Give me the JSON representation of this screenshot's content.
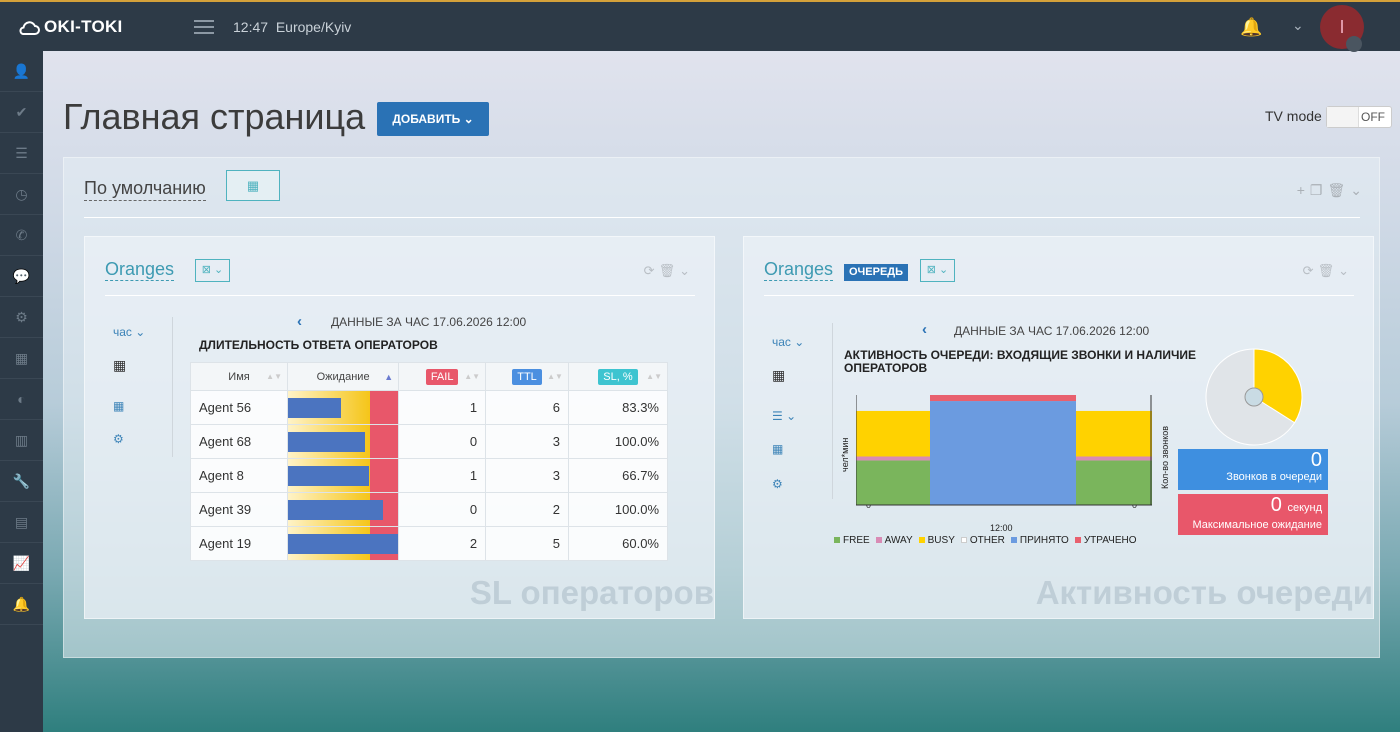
{
  "topbar": {
    "logo": "OKI-TOKI",
    "time": "12:47",
    "timezone": "Europe/Kyiv",
    "avatar_letter": "I"
  },
  "sidebar": {
    "icons": [
      "user-icon",
      "check-icon",
      "list-icon",
      "clock-icon",
      "phone-icon",
      "chat-icon",
      "gears-icon",
      "grid-icon",
      "toggle-icon",
      "bar-chart-icon",
      "wrench-icon",
      "table-icon",
      "line-chart-icon",
      "bell-icon"
    ]
  },
  "page": {
    "title": "Главная страница",
    "add_button": "ДОБАВИТЬ",
    "tv_label": "TV mode",
    "tv_state": "OFF"
  },
  "dashboard": {
    "title": "По умолчанию"
  },
  "widget1": {
    "title": "Oranges",
    "period": "час",
    "data_label": "ДАННЫЕ ЗА  ЧАС  17.06.2026 12:00",
    "chart_title": "ДЛИТЕЛЬНОСТЬ ОТВЕТА ОПЕРАТОРОВ",
    "columns": {
      "name": "Имя",
      "wait": "Ожидание",
      "fail": "FAIL",
      "ttl": "TTL",
      "sl": "SL, %"
    },
    "rows": [
      {
        "name": "Agent 56",
        "wait": 0.48,
        "fail": "1",
        "ttl": "6",
        "sl": "83.3%"
      },
      {
        "name": "Agent 68",
        "wait": 0.7,
        "fail": "0",
        "ttl": "3",
        "sl": "100.0%"
      },
      {
        "name": "Agent 8",
        "wait": 0.74,
        "fail": "1",
        "ttl": "3",
        "sl": "66.7%"
      },
      {
        "name": "Agent 39",
        "wait": 0.86,
        "fail": "0",
        "ttl": "2",
        "sl": "100.0%"
      },
      {
        "name": "Agent 19",
        "wait": 1.0,
        "fail": "2",
        "ttl": "5",
        "sl": "60.0%"
      }
    ],
    "watermark": "SL операторов"
  },
  "widget2": {
    "title": "Oranges",
    "badge": "ОЧЕРЕДЬ",
    "period": "час",
    "data_label": "ДАННЫЕ ЗА  ЧАС  17.06.2026 12:00",
    "chart_title": "АКТИВНОСТЬ ОЧЕРЕДИ: ВХОДЯЩИЕ ЗВОНКИ И НАЛИЧИЕ ОПЕРАТОРОВ",
    "y_left_label": "чел*мин",
    "y_right_label": "Кол-во звонков",
    "x_tick": "12:00",
    "y_left_ticks": [
      "0",
      "100",
      "200"
    ],
    "y_right_ticks": [
      "0",
      "10",
      "20"
    ],
    "legend": [
      {
        "name": "FREE",
        "color": "#7ab55c"
      },
      {
        "name": "AWAY",
        "color": "#d98bb5"
      },
      {
        "name": "BUSY",
        "color": "#ffd200"
      },
      {
        "name": "OTHER",
        "color": "#ffffff"
      },
      {
        "name": "ПРИНЯТО",
        "color": "#6b9be0"
      },
      {
        "name": "УТРАЧЕНО",
        "color": "#e8606e"
      }
    ],
    "queue_value": "0",
    "queue_label": "Звонков в очереди",
    "wait_value": "0",
    "wait_unit": "секунд",
    "wait_label": "Максимальное ожидание",
    "watermark": "Активность очереди"
  },
  "chart_data": [
    {
      "type": "bar",
      "title": "ДЛИТЕЛЬНОСТЬ ОТВЕТА ОПЕРАТОРОВ",
      "categories": [
        "Agent 56",
        "Agent 68",
        "Agent 8",
        "Agent 39",
        "Agent 19"
      ],
      "series": [
        {
          "name": "Ожидание",
          "values": [
            0.48,
            0.7,
            0.74,
            0.86,
            1.0
          ]
        }
      ]
    },
    {
      "type": "bar",
      "title": "АКТИВНОСТЬ ОЧЕРЕДИ: ВХОДЯЩИЕ ЗВОНКИ И НАЛИЧИЕ ОПЕРАТОРОВ",
      "categories": [
        "12:00"
      ],
      "series": [
        {
          "name": "FREE",
          "values": [
            90
          ]
        },
        {
          "name": "AWAY",
          "values": [
            8
          ]
        },
        {
          "name": "BUSY",
          "values": [
            92
          ]
        },
        {
          "name": "ПРИНЯТО",
          "values": [
            21
          ]
        },
        {
          "name": "УТРАЧЕНО",
          "values": [
            2
          ]
        }
      ],
      "ylim_left": [
        0,
        200
      ],
      "ylim_right": [
        0,
        20
      ]
    },
    {
      "type": "pie",
      "values": [
        0.34,
        0.66
      ],
      "colors": [
        "#ffd200",
        "#e0e4e8"
      ]
    }
  ]
}
